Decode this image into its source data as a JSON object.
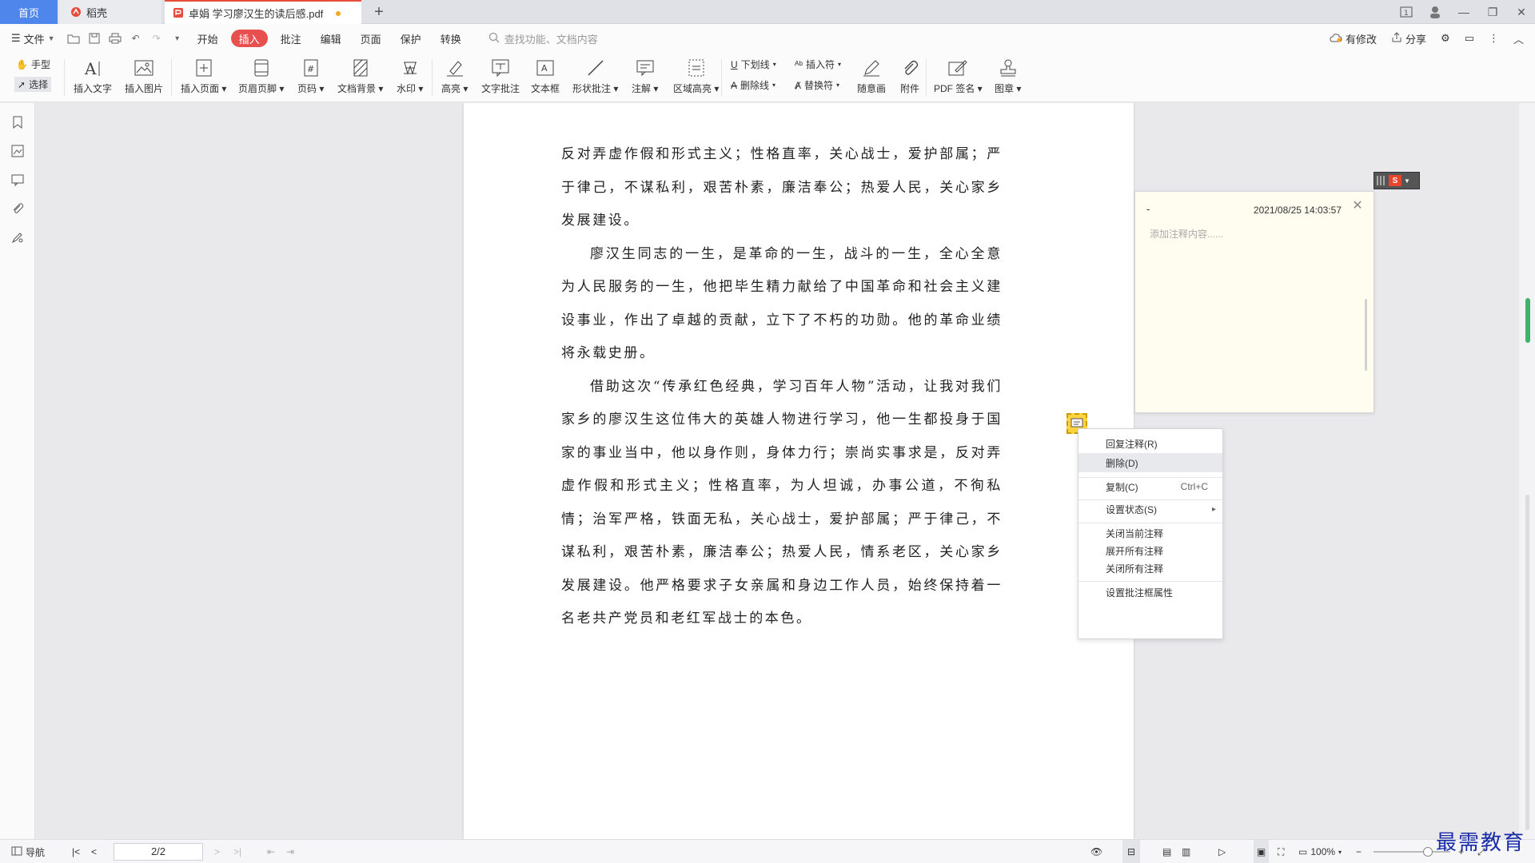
{
  "tabs": {
    "home": "首页",
    "daoke": "稻壳",
    "document": "卓娟 学习廖汉生的读后感.pdf"
  },
  "menu": {
    "file": "文件",
    "items": [
      "开始",
      "插入",
      "批注",
      "编辑",
      "页面",
      "保护",
      "转换"
    ],
    "active": "插入",
    "search_placeholder": "查找功能、文档内容",
    "right": {
      "modified": "有修改",
      "share": "分享"
    }
  },
  "ribbon": {
    "hand": "手型",
    "select": "选择",
    "insert_text": "插入文字",
    "insert_image": "插入图片",
    "insert_page": "插入页面",
    "header_footer": "页眉页脚",
    "page_number": "页码",
    "doc_background": "文档背景",
    "watermark": "水印",
    "highlight": "高亮",
    "text_annotation": "文字批注",
    "textbox": "文本框",
    "shape_annotation": "形状批注",
    "note": "注解",
    "area_highlight": "区域高亮",
    "underline": "下划线",
    "strikethrough": "删除线",
    "insert_symbol": "插入符",
    "replace_symbol": "替换符",
    "freehand": "随意画",
    "attachment": "附件",
    "pdf_sign": "PDF 签名",
    "stamp": "图章"
  },
  "document": {
    "paragraphs": [
      "反对弄虚作假和形式主义；性格直率，关心战士，爱护部属；严于律己，不谋私利，艰苦朴素，廉洁奉公；热爱人民，关心家乡发展建设。",
      "廖汉生同志的一生，是革命的一生，战斗的一生，全心全意为人民服务的一生，他把毕生精力献给了中国革命和社会主义建设事业，作出了卓越的贡献，立下了不朽的功勋。他的革命业绩将永载史册。",
      "借助这次“传承红色经典，学习百年人物”活动，让我对我们家乡的廖汉生这位伟大的英雄人物进行学习，他一生都投身于国家的事业当中，他以身作则，身体力行；崇尚实事求是，反对弄虚作假和形式主义；性格直率，为人坦诚，办事公道，不徇私情；治军严格，铁面无私，关心战士，爱护部属；严于律己，不谋私利，艰苦朴素，廉洁奉公；热爱人民，情系老区，关心家乡发展建设。他严格要求子女亲属和身边工作人员，始终保持着一名老共产党员和老红军战士的本色。"
    ]
  },
  "comment": {
    "author": "-",
    "timestamp": "2021/08/25 14:03:57",
    "placeholder": "添加注释内容......"
  },
  "context_menu": {
    "reply": "回复注释(R)",
    "delete": "删除(D)",
    "copy": "复制(C)",
    "copy_shortcut": "Ctrl+C",
    "set_status": "设置状态(S)",
    "close_current": "关闭当前注释",
    "expand_all": "展开所有注释",
    "close_all": "关闭所有注释",
    "set_props": "设置批注框属性"
  },
  "status": {
    "nav": "导航",
    "page": "2/2",
    "zoom": "100%"
  },
  "watermark_text": "最需教育",
  "colors": {
    "accent": "#4f86ec",
    "active_tab": "#e84f4f",
    "comment_bg": "#fffdf0",
    "scroll_thumb": "#3fb36e"
  }
}
